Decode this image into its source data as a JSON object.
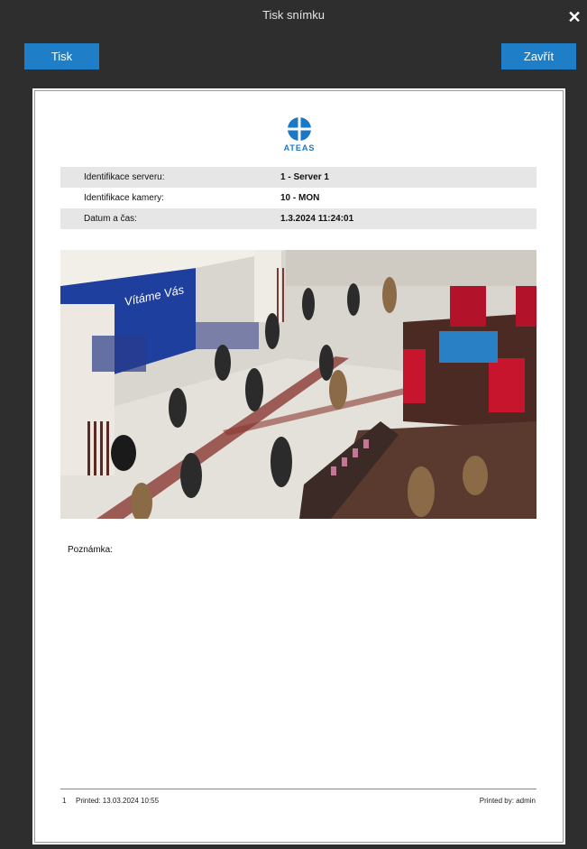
{
  "window": {
    "title": "Tisk snímku",
    "close_glyph": "✕"
  },
  "toolbar": {
    "print_label": "Tisk",
    "close_label": "Zavřít"
  },
  "report": {
    "logo_text": "ATEAS",
    "logo_color": "#1b78c4",
    "rows": [
      {
        "label": "Identifikace serveru:",
        "value": "1 - Server 1"
      },
      {
        "label": "Identifikace kamery:",
        "value": "10 - MON"
      },
      {
        "label": "Datum a čas:",
        "value": "1.3.2024 11:24:01"
      }
    ],
    "snapshot_sign": "Vítáme Vás",
    "note_label": "Poznámka:",
    "footer": {
      "page_number": "1",
      "printed": "Printed: 13.03.2024 10:55",
      "printed_by": "Printed by: admin"
    }
  }
}
